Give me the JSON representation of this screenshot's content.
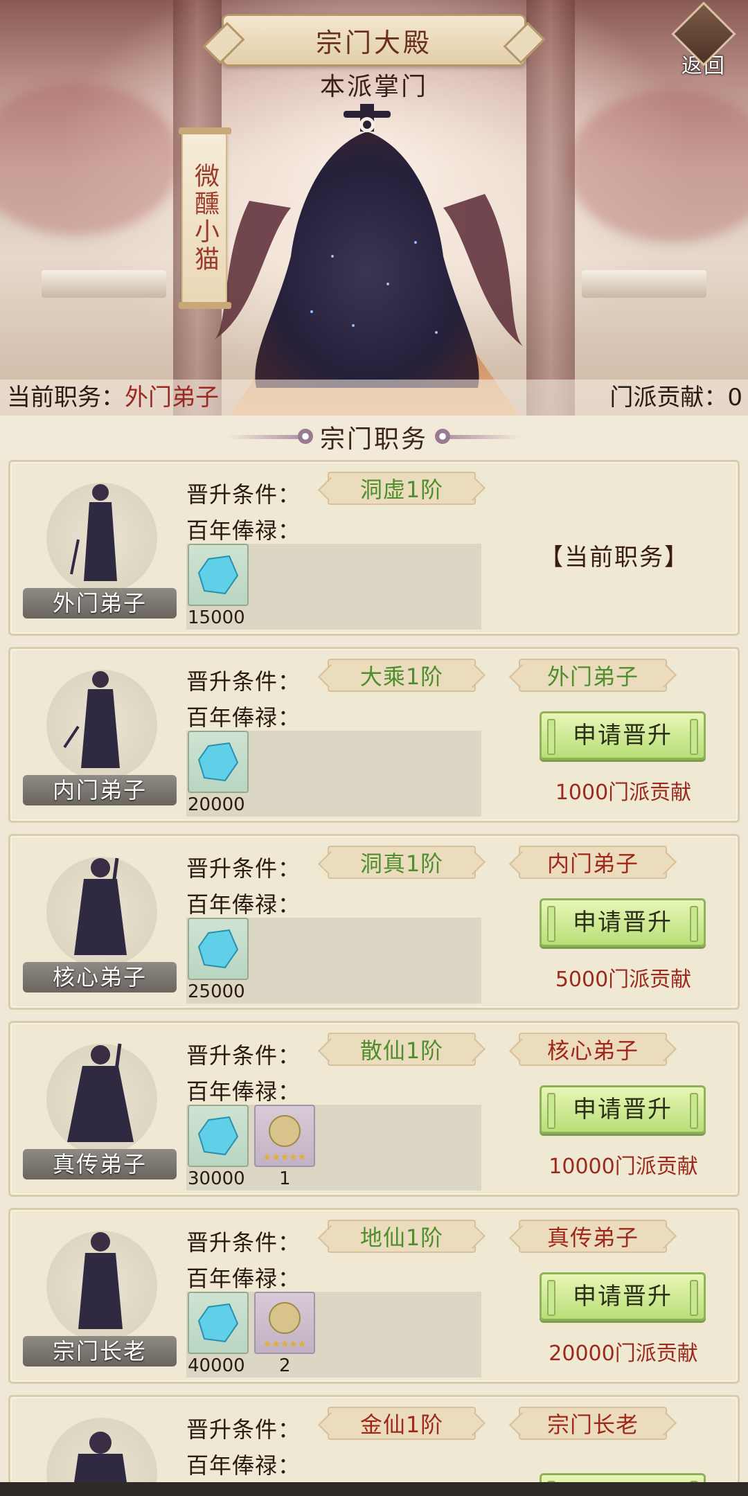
{
  "header": {
    "title": "宗门大殿",
    "leader_label": "本派掌门",
    "back_label": "返回",
    "leader_name": "微醺小猫",
    "current_duty_label": "当前职务：",
    "current_duty_value": "外门弟子",
    "contribution_label": "门派贡献：",
    "contribution_value": "0"
  },
  "section": {
    "title": "宗门职务"
  },
  "labels": {
    "promotion_condition": "晋升条件：",
    "salary": "百年俸禄：",
    "current_duty_tag": "【当前职务】",
    "apply_button": "申请晋升"
  },
  "ranks": [
    {
      "name": "外门弟子",
      "realm": "洞虚1阶",
      "prev_rank": "",
      "gems": "15000",
      "pills": "",
      "cost": "",
      "is_current": true
    },
    {
      "name": "内门弟子",
      "realm": "大乘1阶",
      "prev_rank": "外门弟子",
      "prev_met": true,
      "gems": "20000",
      "pills": "",
      "cost": "1000门派贡献"
    },
    {
      "name": "核心弟子",
      "realm": "洞真1阶",
      "prev_rank": "内门弟子",
      "prev_met": false,
      "gems": "25000",
      "pills": "",
      "cost": "5000门派贡献"
    },
    {
      "name": "真传弟子",
      "realm": "散仙1阶",
      "prev_rank": "核心弟子",
      "prev_met": false,
      "gems": "30000",
      "pills": "1",
      "cost": "10000门派贡献"
    },
    {
      "name": "宗门长老",
      "realm": "地仙1阶",
      "prev_rank": "真传弟子",
      "prev_met": false,
      "gems": "40000",
      "pills": "2",
      "cost": "20000门派贡献"
    },
    {
      "name": "",
      "realm": "金仙1阶",
      "prev_rank": "宗门长老",
      "prev_met": false,
      "gems": "",
      "pills": "",
      "cost": ""
    }
  ],
  "colors": {
    "met": "#4f8e2f",
    "unmet": "#a0281a",
    "cost": "#9b2a1e"
  },
  "icons": {
    "gem": "blue-spirit-stone-icon",
    "pill": "golden-pill-icon",
    "back": "back-diamond-icon"
  }
}
